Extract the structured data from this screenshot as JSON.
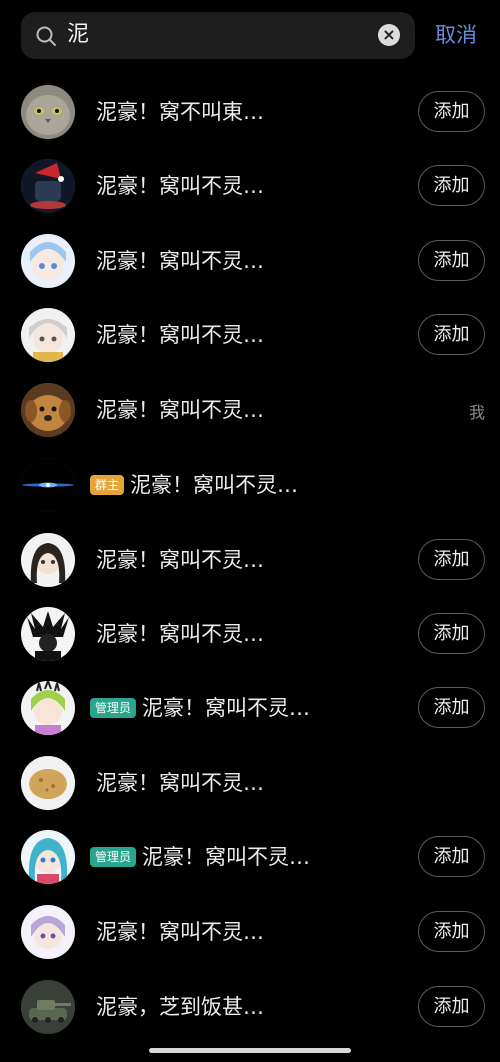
{
  "search": {
    "query": "泥",
    "cancel_label": "取消"
  },
  "add_label": "添加",
  "me_label": "我",
  "badges": {
    "owner": "群主",
    "admin": "管理员"
  },
  "members": [
    {
      "name": "泥豪！窝不叫東…",
      "action": "add",
      "avatar": "cat-avatar"
    },
    {
      "name": "泥豪！窝叫不灵…",
      "action": "add",
      "avatar": "santa-hat-avatar"
    },
    {
      "name": "泥豪！窝叫不灵…",
      "action": "add",
      "avatar": "anime-blue-avatar"
    },
    {
      "name": "泥豪！窝叫不灵…",
      "action": "add",
      "avatar": "anime-white-hair-avatar"
    },
    {
      "name": "泥豪！窝叫不灵…",
      "action": "me",
      "avatar": "dog-avatar"
    },
    {
      "name": "泥豪！窝叫不灵…",
      "action": "none",
      "badge": "owner",
      "avatar": "blue-light-avatar"
    },
    {
      "name": "泥豪！窝叫不灵…",
      "action": "add",
      "avatar": "anime-dark-hair-avatar"
    },
    {
      "name": "泥豪！窝叫不灵…",
      "action": "add",
      "avatar": "monochrome-art-avatar"
    },
    {
      "name": "泥豪！窝叫不灵…",
      "action": "add",
      "badge": "admin",
      "avatar": "green-hair-avatar"
    },
    {
      "name": "泥豪！窝叫不灵…",
      "action": "none",
      "avatar": "potato-avatar"
    },
    {
      "name": "泥豪！窝叫不灵…",
      "action": "add",
      "badge": "admin",
      "avatar": "miku-avatar"
    },
    {
      "name": "泥豪！窝叫不灵…",
      "action": "add",
      "avatar": "purple-hair-avatar"
    },
    {
      "name": "泥豪，芝到饭甚…",
      "action": "add",
      "avatar": "tank-avatar"
    }
  ]
}
